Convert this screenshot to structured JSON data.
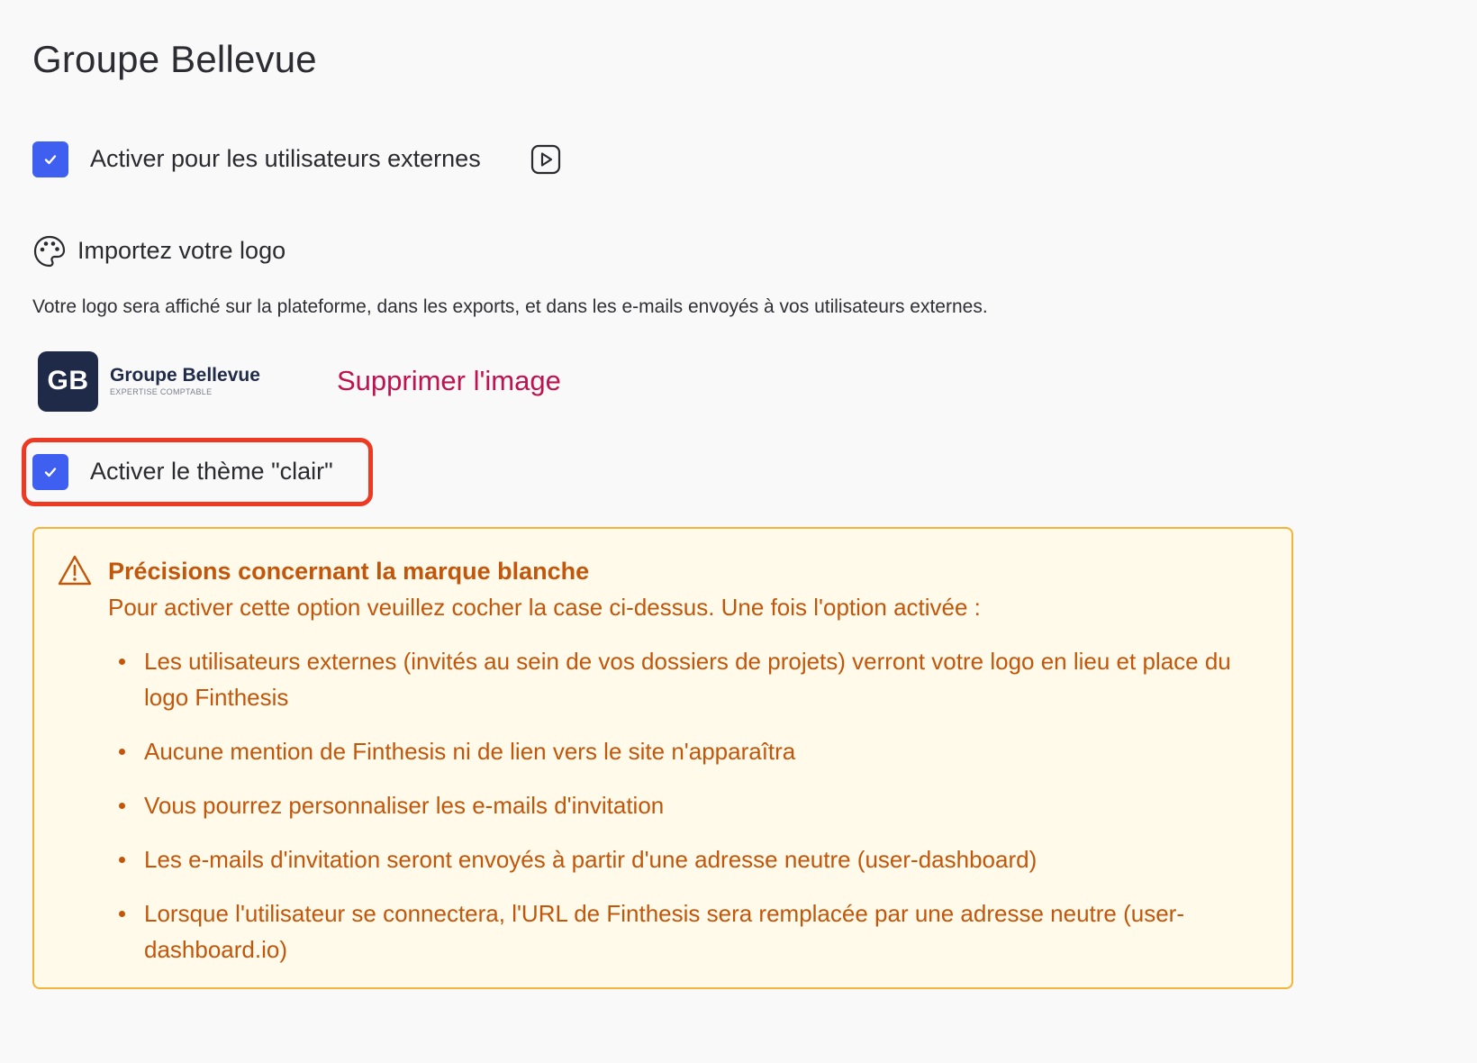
{
  "page": {
    "title": "Groupe Bellevue"
  },
  "external_users": {
    "checked": true,
    "label": "Activer pour les utilisateurs externes"
  },
  "logo_section": {
    "title": "Importez votre logo",
    "description": "Votre logo sera affiché sur la plateforme, dans les exports, et dans les e-mails envoyés à vos utilisateurs externes.",
    "logo": {
      "initials": "GB",
      "name": "Groupe Bellevue",
      "tagline": "EXPERTISE COMPTABLE"
    },
    "delete_label": "Supprimer l'image"
  },
  "theme": {
    "checked": true,
    "label": "Activer le thème \"clair\""
  },
  "warning": {
    "title": "Précisions concernant la marque blanche",
    "intro": "Pour activer cette option veuillez cocher la case ci-dessus. Une fois l'option activée :",
    "items": [
      "Les utilisateurs externes (invités au sein de vos dossiers de projets) verront votre logo en lieu et place du logo Finthesis",
      "Aucune mention de Finthesis ni de lien vers le site n'apparaîtra",
      "Vous pourrez personnaliser les e-mails d'invitation",
      "Les e-mails d'invitation seront envoyés à partir d'une adresse neutre (user-dashboard)",
      "Lorsque l'utilisateur se connectera, l'URL de Finthesis sera remplacée par une adresse neutre (user-dashboard.io)"
    ]
  },
  "colors": {
    "accent": "#3e5ff0",
    "danger": "#c0124f",
    "warning_text": "#c2570c",
    "warning_bg": "#fffaea",
    "warning_border": "#f3b43c",
    "highlight": "#ef3a23"
  },
  "icons": {
    "checkbox": "check-icon",
    "play": "play-video-icon",
    "palette": "palette-icon",
    "warning": "warning-triangle-icon"
  }
}
